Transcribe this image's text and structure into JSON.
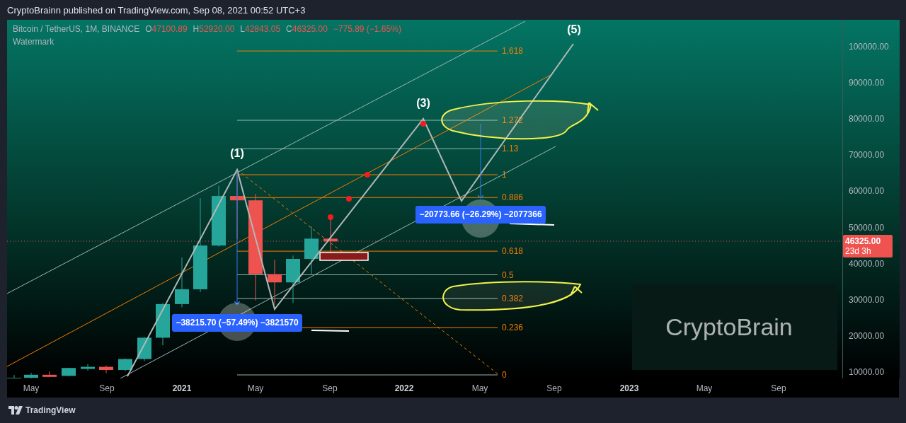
{
  "header": {
    "publisher_line": "CryptoBrainn published on TradingView.com, Sep 08, 2021 00:52 UTC+3"
  },
  "legend": {
    "symbol": "Bitcoin / TetherUS, 1M, BINANCE",
    "ohlc": [
      {
        "letter": "O",
        "value": "47100.89"
      },
      {
        "letter": "H",
        "value": "52920.00"
      },
      {
        "letter": "L",
        "value": "42843.05"
      },
      {
        "letter": "C",
        "value": "46325.00"
      }
    ],
    "change": "−775.89 (−1.65%)",
    "indicator": "Watermark"
  },
  "fib_levels": [
    {
      "label": "1.618"
    },
    {
      "label": "1.272"
    },
    {
      "label": "1.13"
    },
    {
      "label": "1"
    },
    {
      "label": "0.886"
    },
    {
      "label": "0.618"
    },
    {
      "label": "0.5"
    },
    {
      "label": "0.382"
    },
    {
      "label": "0.236"
    },
    {
      "label": "0"
    }
  ],
  "wave_labels": [
    {
      "text": "(1)"
    },
    {
      "text": "(3)"
    },
    {
      "text": "(5)"
    }
  ],
  "measurements": [
    {
      "text": "−38215.70 (−57.49%) −3821570"
    },
    {
      "text": "−20773.66 (−26.29%) −2077366"
    }
  ],
  "watermark": {
    "text": "CryptoBrain"
  },
  "price_axis": {
    "labels": [
      "100000.00",
      "90000.00",
      "80000.00",
      "70000.00",
      "60000.00",
      "50000.00",
      "40000.00",
      "30000.00",
      "20000.00",
      "10000.00"
    ],
    "last_price": {
      "value": "46325.00",
      "countdown": "23d 3h"
    }
  },
  "time_axis": {
    "labels": [
      {
        "text": "May",
        "kind": "month"
      },
      {
        "text": "Sep",
        "kind": "month"
      },
      {
        "text": "2021",
        "kind": "year"
      },
      {
        "text": "May",
        "kind": "month"
      },
      {
        "text": "Sep",
        "kind": "month"
      },
      {
        "text": "2022",
        "kind": "year"
      },
      {
        "text": "May",
        "kind": "month"
      },
      {
        "text": "Sep",
        "kind": "month"
      },
      {
        "text": "2023",
        "kind": "year"
      },
      {
        "text": "May",
        "kind": "month"
      },
      {
        "text": "Sep",
        "kind": "month"
      }
    ]
  },
  "footer": {
    "brand": "TradingView"
  }
}
